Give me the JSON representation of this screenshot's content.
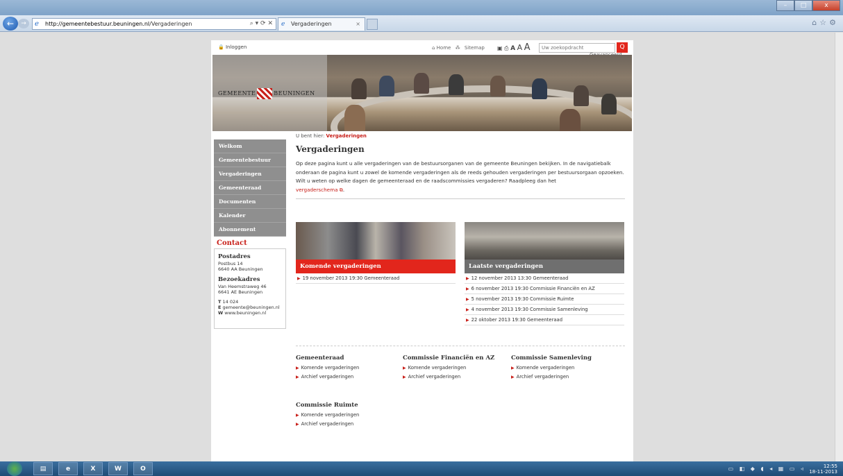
{
  "browser": {
    "url_host": "http://gemeentebestuur.beuningen.nl",
    "url_path": "/Vergaderingen",
    "address_tools": "⌕ ▾ ⟳ ✕",
    "tab_title": "Vergaderingen",
    "tab_close": "×",
    "window_buttons": [
      "–",
      "□",
      "x"
    ]
  },
  "topbar": {
    "login": "🔒 Inloggen",
    "home": "⌂ Home",
    "sitemap": "Sitemap",
    "search_placeholder": "Uw zoekopdracht",
    "search_button": "Q",
    "advanced": "Geavanceerd zoeken",
    "font_a": [
      "A",
      "A",
      "A"
    ]
  },
  "logo": {
    "left": "GEMEENTE",
    "right": "BEUNINGEN"
  },
  "breadcrumb": {
    "prefix": "U bent hier:",
    "current": "Vergaderingen"
  },
  "nav": {
    "items": [
      "Welkom",
      "Gemeentebestuur",
      "Vergaderingen",
      "Gemeenteraad",
      "Documenten",
      "Kalender",
      "Abonnement"
    ]
  },
  "contact": {
    "title": "Contact",
    "post_title": "Postadres",
    "post_line1": "Postbus 14",
    "post_line2": "6640 AA Beuningen",
    "visit_title": "Bezoekadres",
    "visit_line1": "Van Heemstraweg 46",
    "visit_line2": "6641 AE Beuningen",
    "t_label": "T",
    "t_value": "14 024",
    "e_label": "E",
    "e_value": "gemeente@beuningen.nl",
    "w_label": "W",
    "w_value": "www.beuningen.nl"
  },
  "main": {
    "title": "Vergaderingen",
    "intro": "Op deze pagina kunt u alle vergaderingen van de bestuursorganen van de gemeente Beuningen bekijken. In de navigatiebalk onderaan de pagina kunt u zowel de komende vergaderingen als de reeds gehouden vergaderingen per bestuursorgaan opzoeken.",
    "intro2": "Wilt u weten op welke dagen de gemeenteraad en de raadscommissies vergaderen? Raadpleeg dan het",
    "schema_link": "vergaderschema"
  },
  "upcoming": {
    "title": "Komende vergaderingen",
    "items": [
      "19 november 2013 19:30 Gemeenteraad"
    ]
  },
  "latest": {
    "title": "Laatste vergaderingen",
    "items": [
      "12 november 2013 13:30 Gemeenteraad",
      "6 november 2013 19:30 Commissie Financiën en AZ",
      "5 november 2013 19:30 Commissie Ruimte",
      "4 november 2013 19:30 Commissie Samenleving",
      "22 oktober 2013 19:30 Gemeenteraad"
    ]
  },
  "bodies": [
    {
      "title": "Gemeenteraad",
      "link1": "Komende vergaderingen",
      "link2": "Archief vergaderingen"
    },
    {
      "title": "Commissie Financiën en AZ",
      "link1": "Komende vergaderingen",
      "link2": "Archief vergaderingen"
    },
    {
      "title": "Commissie Samenleving",
      "link1": "Komende vergaderingen",
      "link2": "Archief vergaderingen"
    },
    {
      "title": "Commissie Ruimte",
      "link1": "Komende vergaderingen",
      "link2": "Archief vergaderingen"
    }
  ],
  "taskbar": {
    "apps": [
      "e",
      "X",
      "W",
      "O"
    ],
    "time": "12:55",
    "date": "18-11-2013"
  },
  "colors": {
    "accent_red": "#c8201a",
    "nav_grey": "#8f8f8f",
    "latest_caption": "#6f6f6f"
  }
}
